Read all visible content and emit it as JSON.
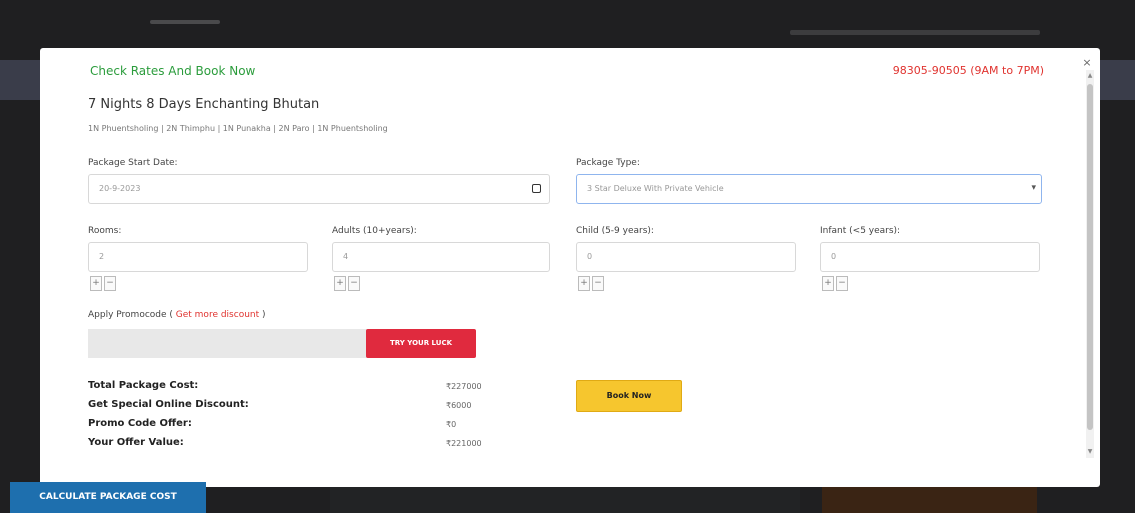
{
  "modal": {
    "title": "Check Rates And Book Now",
    "phone": "98305-90505 (9AM to 7PM)",
    "close": "×",
    "package_title": "7 Nights 8 Days Enchanting Bhutan",
    "route": "1N Phuentsholing | 2N Thimphu | 1N Punakha | 2N Paro | 1N Phuentsholing"
  },
  "form": {
    "start_date_label": "Package Start Date:",
    "start_date_value": "20-9-2023",
    "package_type_label": "Package Type:",
    "package_type_value": "3 Star Deluxe With Private Vehicle",
    "rooms_label": "Rooms:",
    "rooms_value": "2",
    "adults_label": "Adults (10+years):",
    "adults_value": "4",
    "child_label": "Child (5-9 years):",
    "child_value": "0",
    "infant_label": "Infant (<5 years):",
    "infant_value": "0",
    "plus": "+",
    "minus": "−"
  },
  "promo": {
    "label": "Apply Promocode (",
    "link": " Get more discount ",
    "label_end": ")",
    "button": "TRY YOUR LUCK"
  },
  "costs": {
    "total_label": "Total Package Cost:",
    "total_value": "₹227000",
    "special_label": "Get Special Online Discount:",
    "special_value": "₹6000",
    "promo_label": "Promo Code Offer:",
    "promo_value": "₹0",
    "offer_label": "Your Offer Value:",
    "offer_value": "₹221000"
  },
  "buttons": {
    "book_now": "Book Now",
    "calculate": "CALCULATE PACKAGE COST"
  }
}
